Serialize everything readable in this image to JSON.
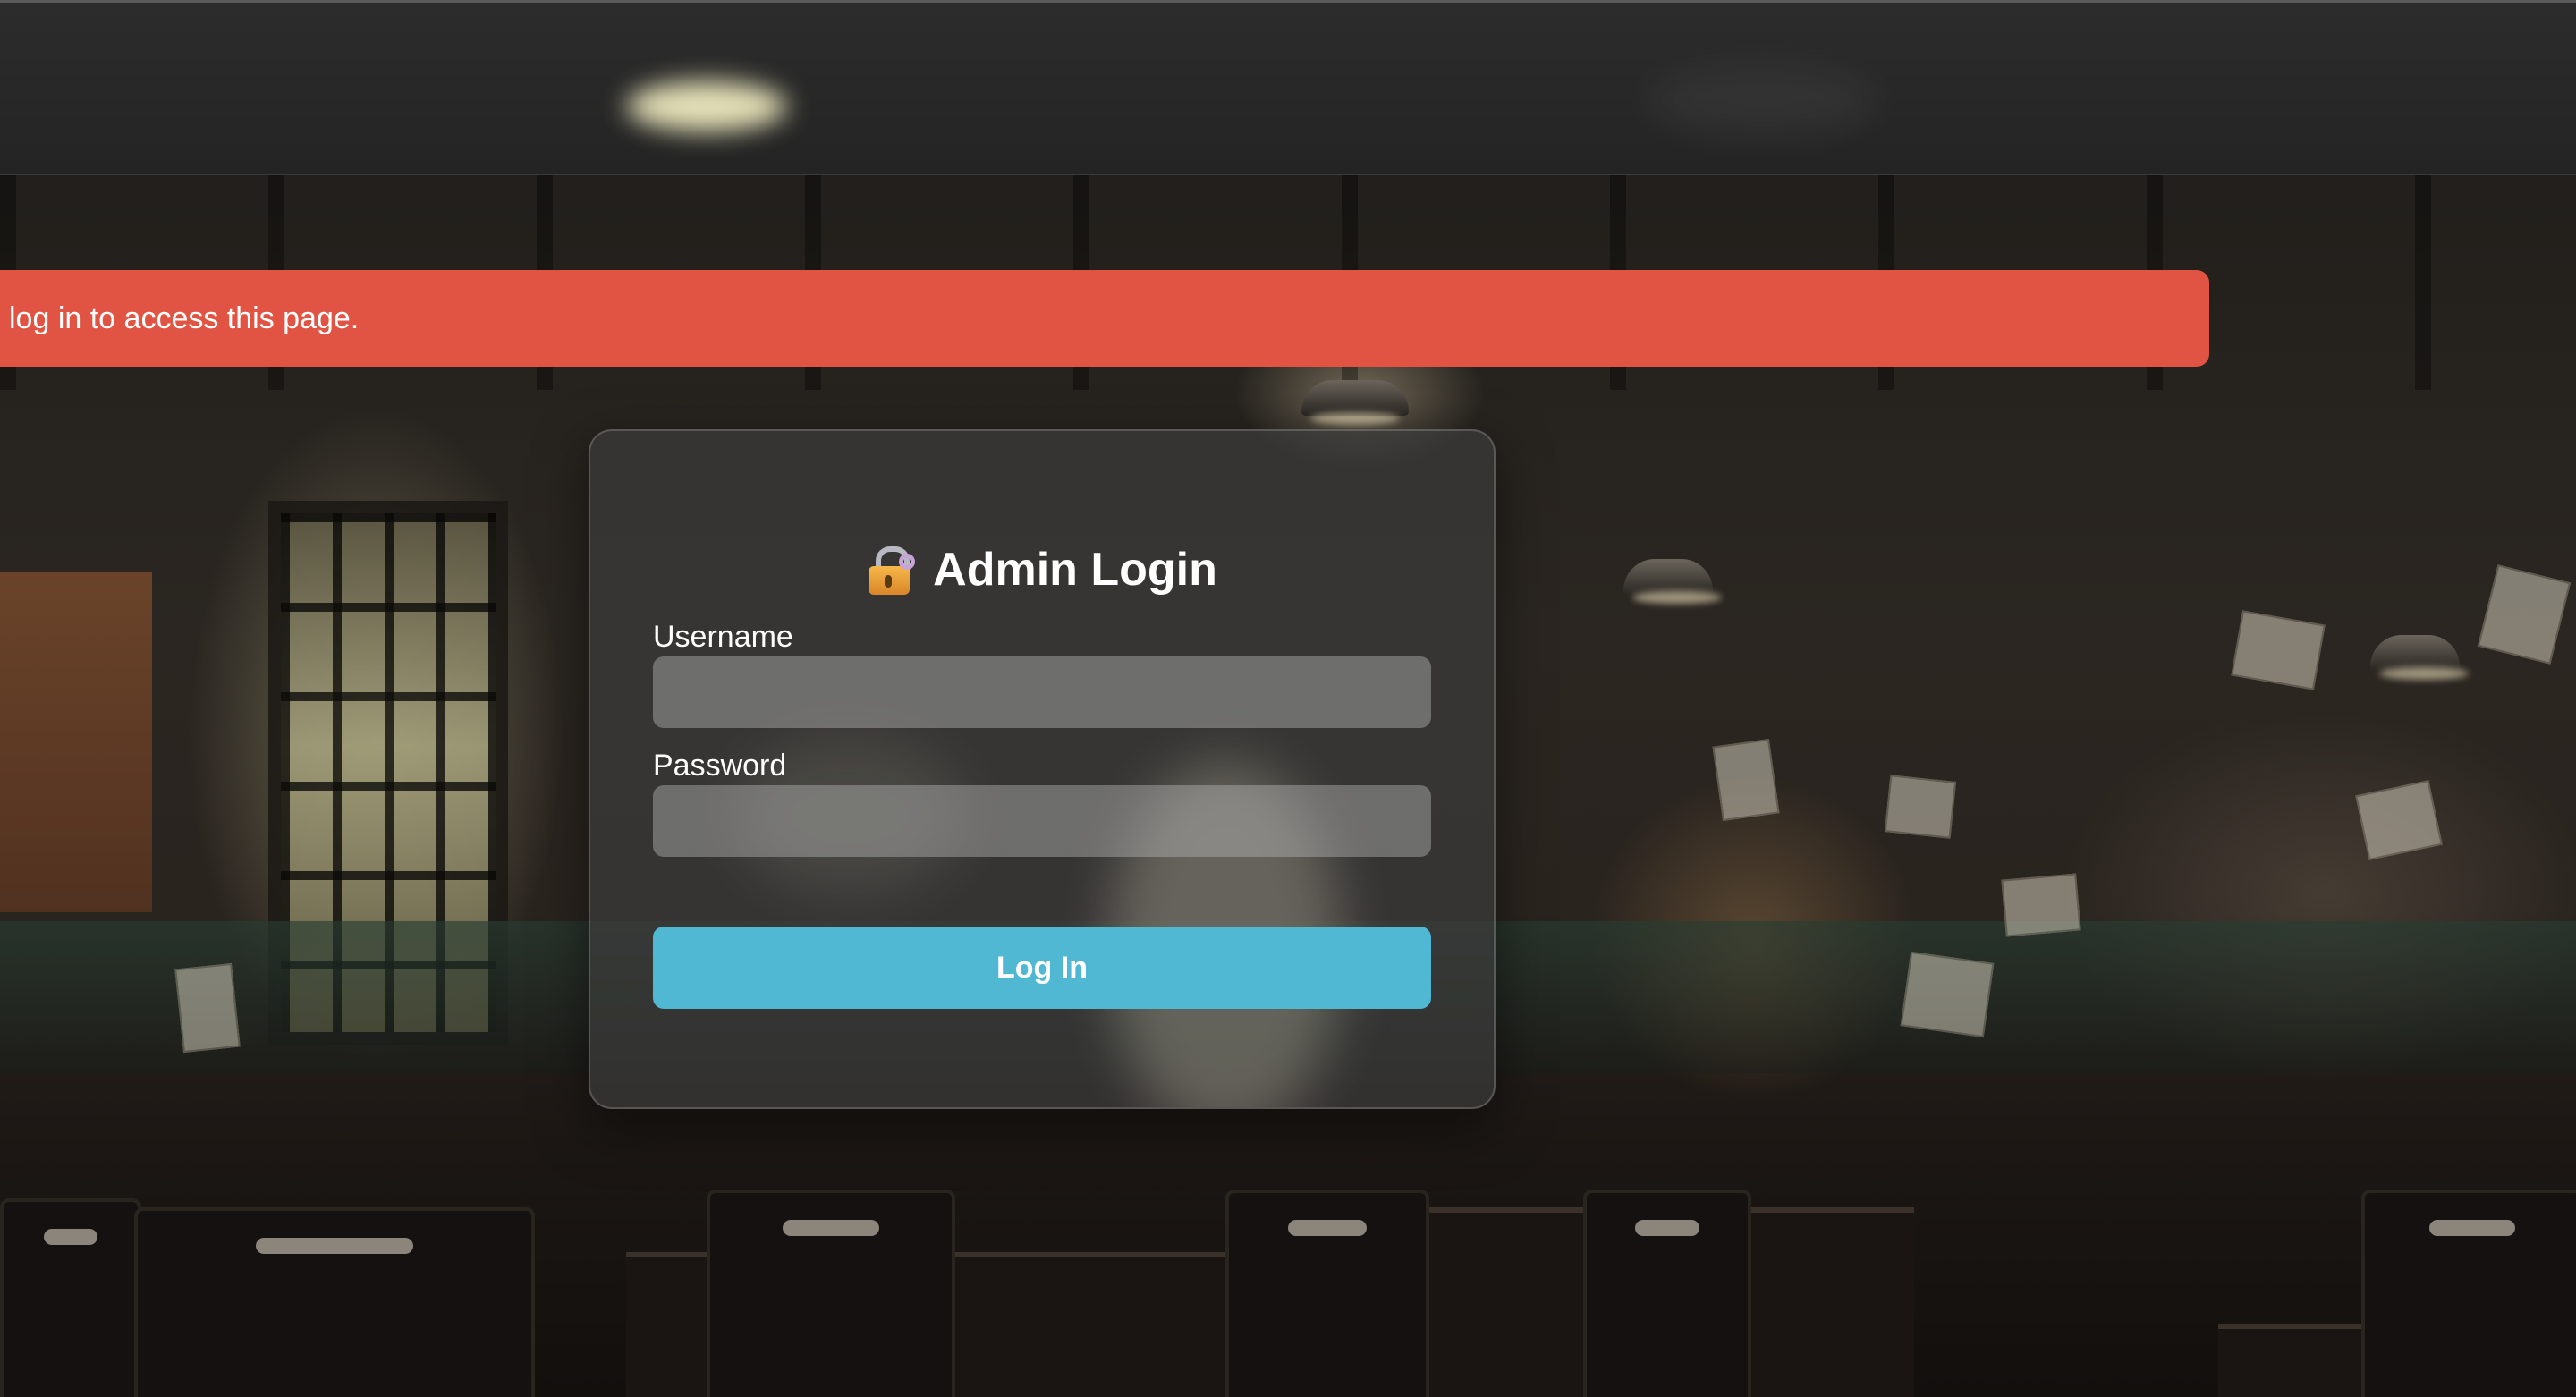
{
  "alert": {
    "message": "log in to access this page.",
    "color": "#e15443"
  },
  "login": {
    "title": "Admin Login",
    "icon": "locked-with-key-icon",
    "username_label": "Username",
    "username_value": "",
    "password_label": "Password",
    "password_value": "",
    "submit_label": "Log In",
    "accent_color": "#50b8d2"
  }
}
